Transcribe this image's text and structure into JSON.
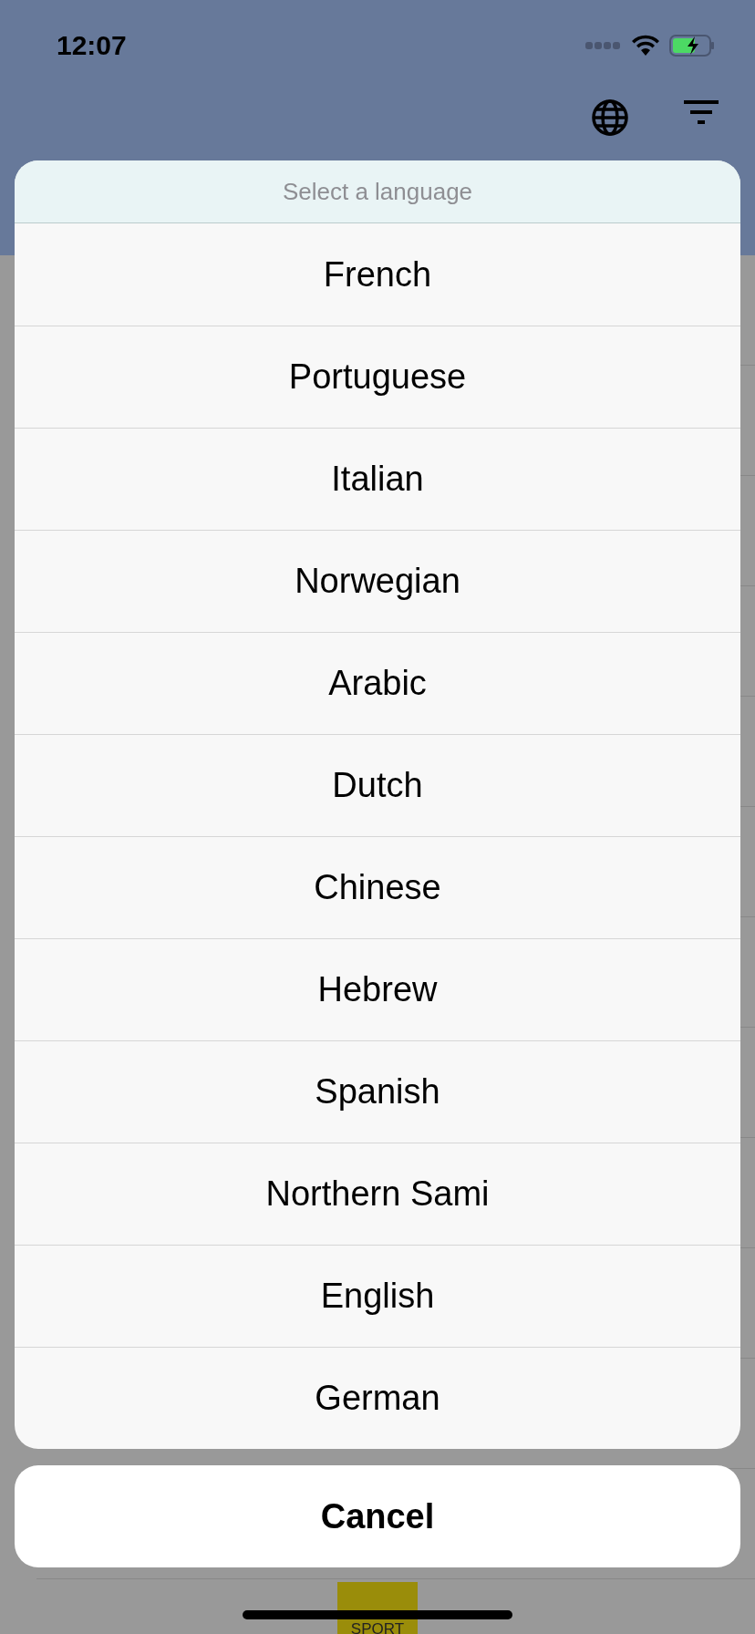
{
  "status_bar": {
    "time": "12:07"
  },
  "sheet": {
    "title": "Select a language",
    "options": [
      {
        "label": "French"
      },
      {
        "label": "Portuguese"
      },
      {
        "label": "Italian"
      },
      {
        "label": "Norwegian"
      },
      {
        "label": "Arabic"
      },
      {
        "label": "Dutch"
      },
      {
        "label": "Chinese"
      },
      {
        "label": "Hebrew"
      },
      {
        "label": "Spanish"
      },
      {
        "label": "Northern Sami"
      },
      {
        "label": "English"
      },
      {
        "label": "German"
      }
    ],
    "cancel": "Cancel"
  },
  "footer_logo": {
    "text": "SPORT"
  }
}
